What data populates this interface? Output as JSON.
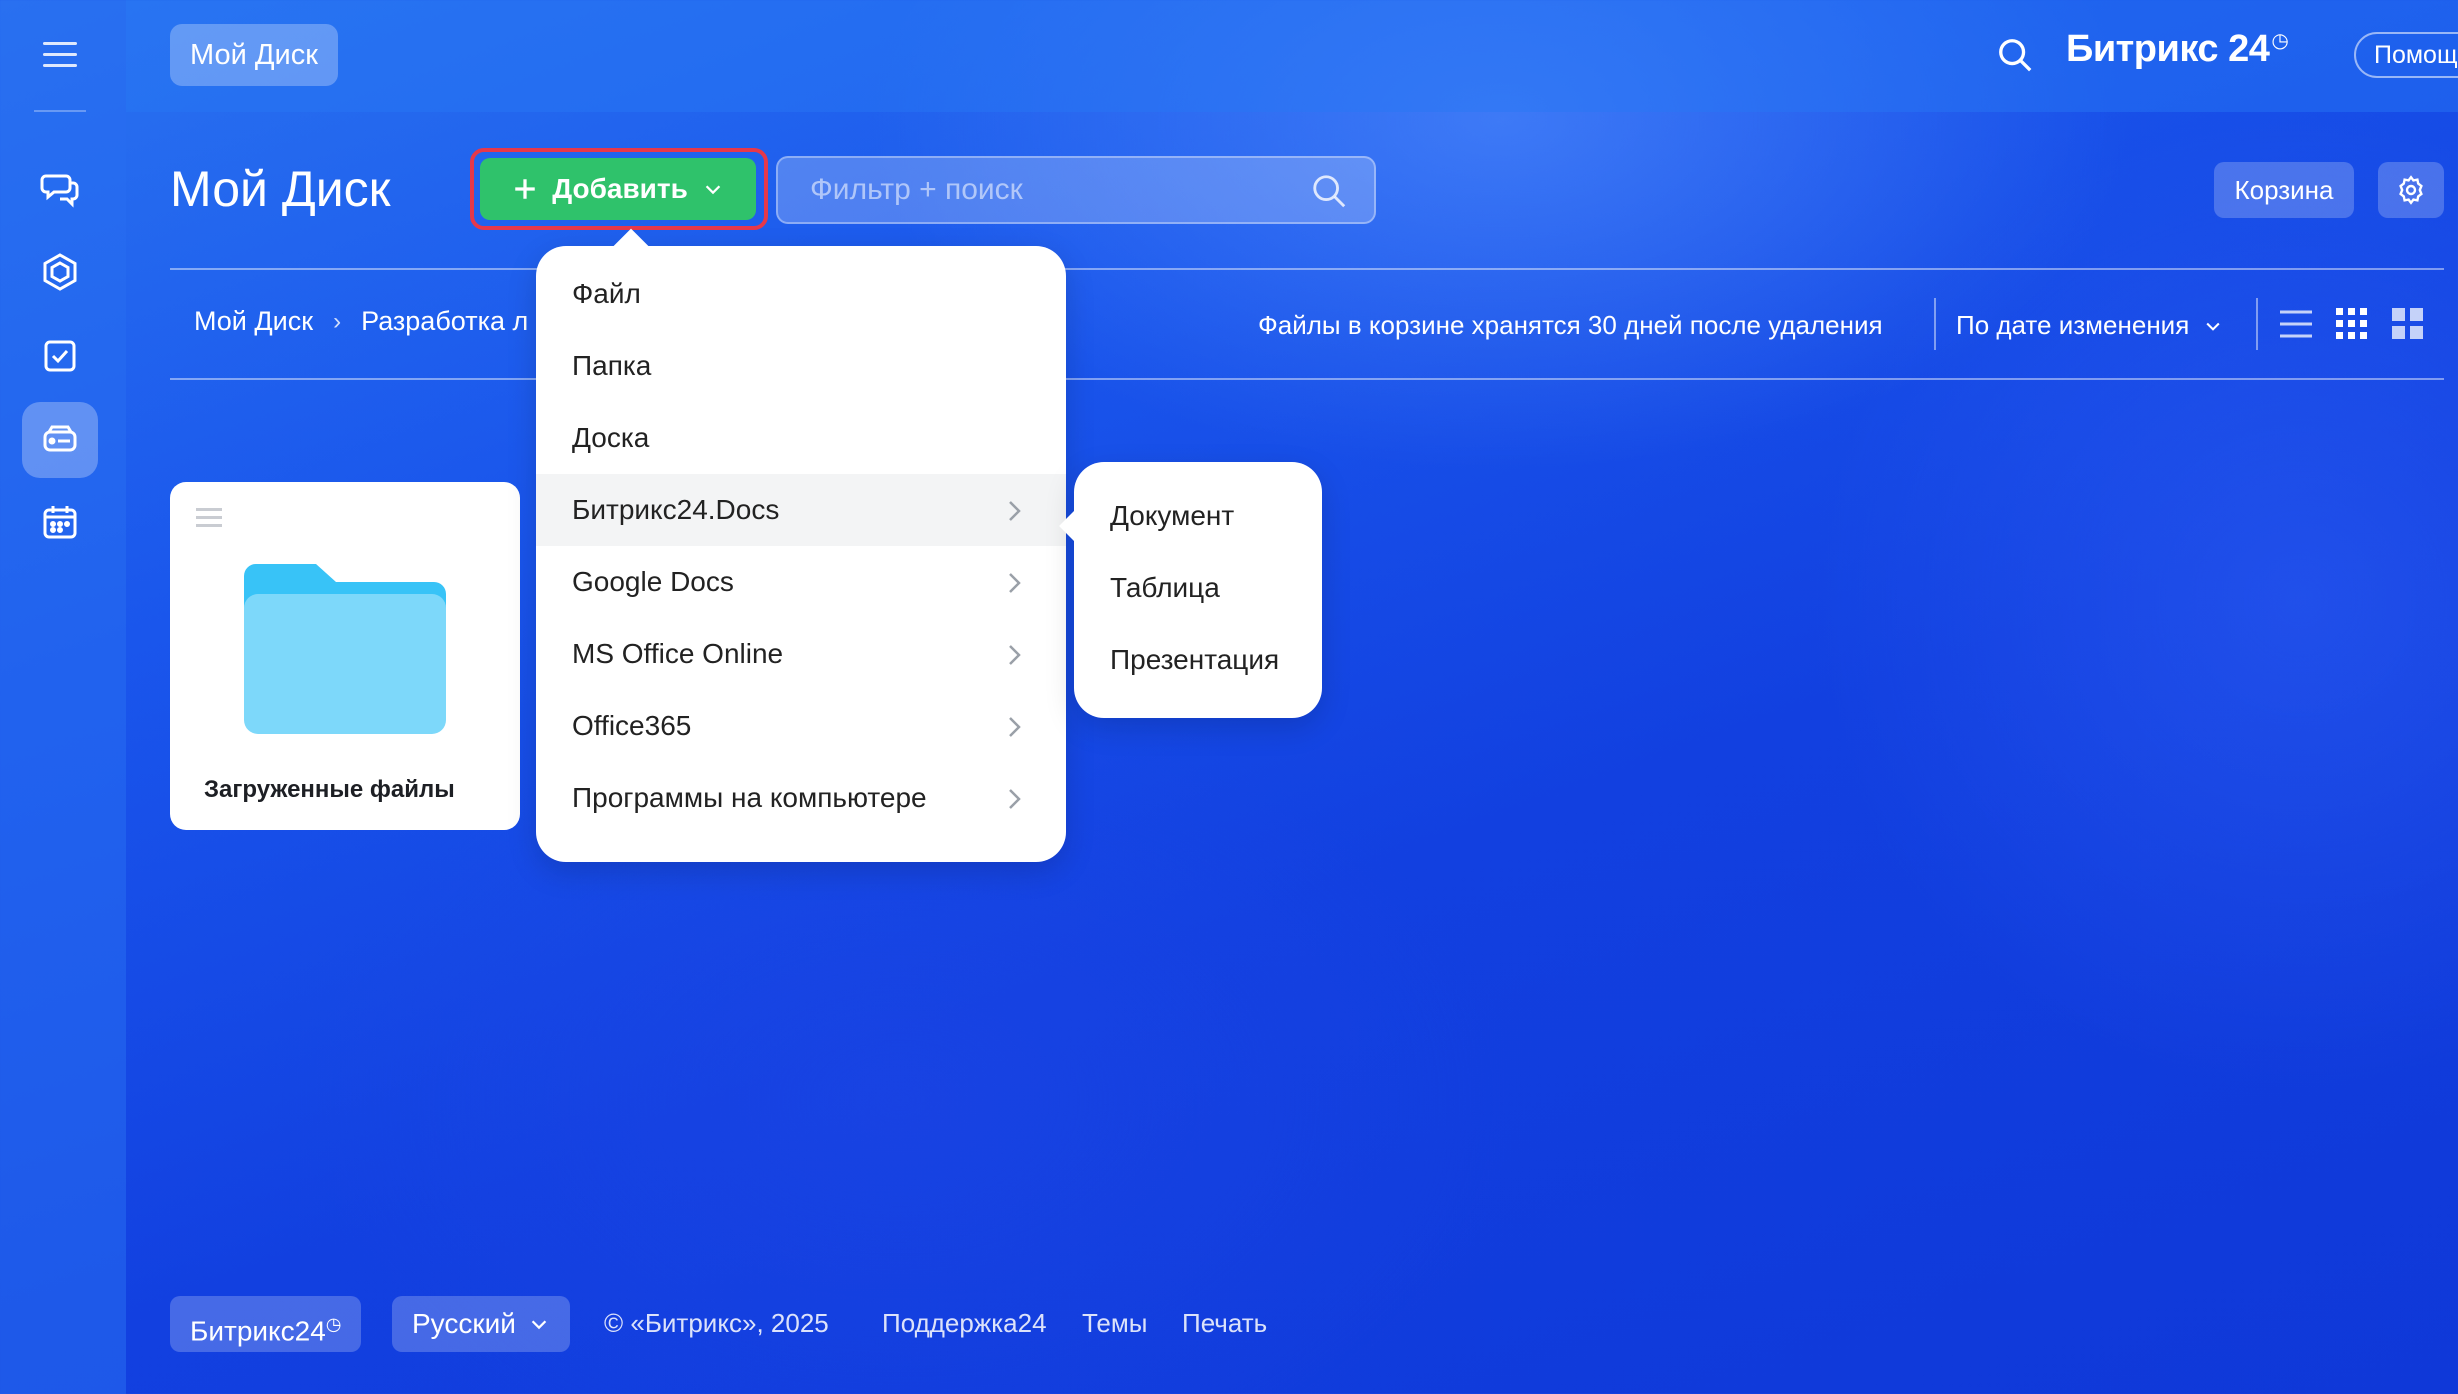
{
  "topbar": {
    "crumb_chip": "Мой Диск",
    "brand": "Битрикс 24",
    "brand_clock": "◷",
    "help": "Помощь"
  },
  "header": {
    "title": "Мой Диск",
    "add_button": "Добавить",
    "search_placeholder": "Фильтр + поиск",
    "trash_button": "Корзина"
  },
  "toolbar": {
    "breadcrumbs": [
      "Мой Диск",
      "Разработка л"
    ],
    "trash_note": "Файлы в корзине хранятся 30 дней после удаления",
    "sort": "По дате изменения"
  },
  "folders": [
    {
      "name": "Загруженные файлы"
    }
  ],
  "add_menu": {
    "items": [
      {
        "label": "Файл",
        "submenu": false
      },
      {
        "label": "Папка",
        "submenu": false
      },
      {
        "label": "Доска",
        "submenu": false
      },
      {
        "label": "Битрикс24.Docs",
        "submenu": true,
        "highlighted": true
      },
      {
        "label": "Google Docs",
        "submenu": true
      },
      {
        "label": "MS Office Online",
        "submenu": true
      },
      {
        "label": "Office365",
        "submenu": true
      },
      {
        "label": "Программы на компьютере",
        "submenu": true
      }
    ],
    "submenu_items": [
      "Документ",
      "Таблица",
      "Презентация"
    ]
  },
  "footer": {
    "brand": "Битрикс24",
    "brand_clock": "◷",
    "language": "Русский",
    "copyright": "© «Битрикс», 2025",
    "support": "Поддержка24",
    "themes": "Темы",
    "print": "Печать"
  },
  "colors": {
    "add_button": "#2fc26b",
    "add_highlight_outline": "#e6384b",
    "folder": "#7dd8fa",
    "folder_tab": "#38c3f7"
  },
  "icons": {
    "rail": [
      "menu-icon",
      "chat-icon",
      "hexagon-icon",
      "tasks-icon",
      "drive-icon",
      "calendar-icon"
    ],
    "toolbar": [
      "list-view-icon",
      "grid-small-icon",
      "grid-large-icon"
    ]
  }
}
